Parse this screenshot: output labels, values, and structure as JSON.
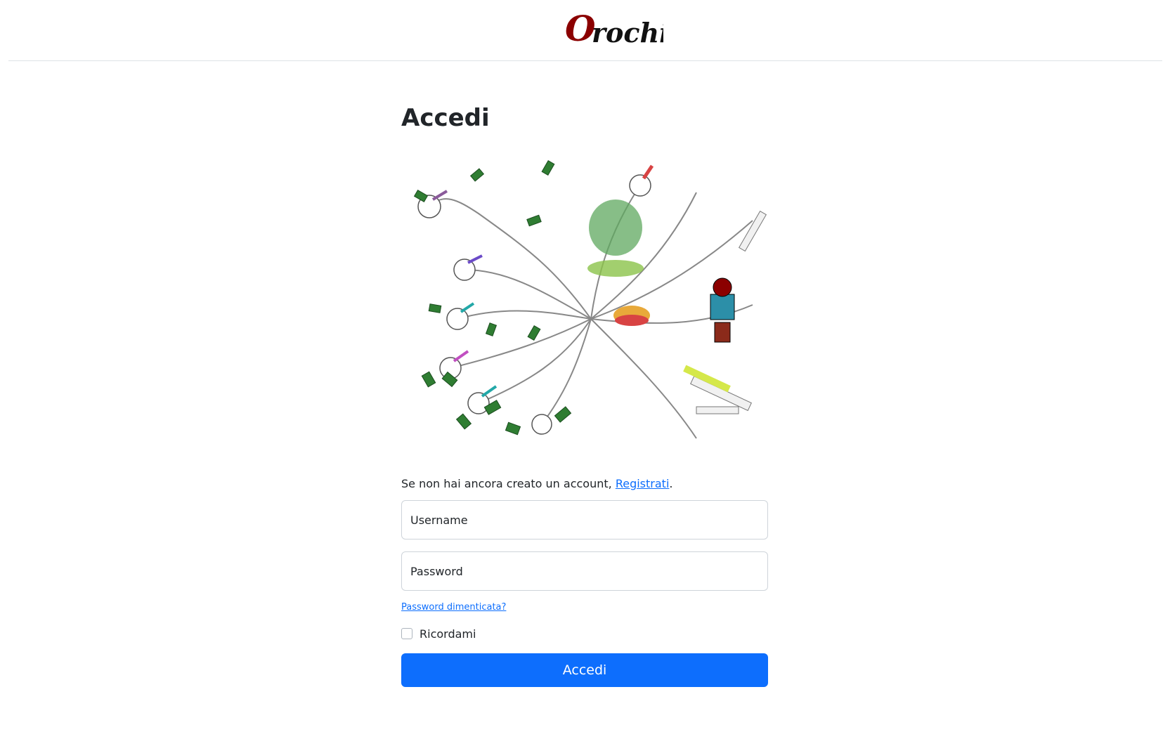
{
  "brand": {
    "logo_text": "Orochi",
    "accent_color": "#8b0000"
  },
  "login": {
    "title": "Accedi",
    "signup_prompt": "Se non hai ancora creato un account, ",
    "signup_link": "Registrati",
    "signup_suffix": ".",
    "username_placeholder": "Username",
    "password_placeholder": "Password",
    "forgot_password": "Password dimenticata?",
    "remember_me": "Ricordami",
    "remember_checked": false,
    "submit_label": "Accedi"
  },
  "illustration": {
    "subject": "eight-headed-serpent-orochi",
    "accent_colors": [
      "#2f7d32",
      "#d84343",
      "#6b4bc8",
      "#23a8a8",
      "#c14fc1",
      "#e8a93a"
    ]
  },
  "theme": {
    "primary": "#0d6efd",
    "border": "#ced4da",
    "text": "#212529"
  }
}
